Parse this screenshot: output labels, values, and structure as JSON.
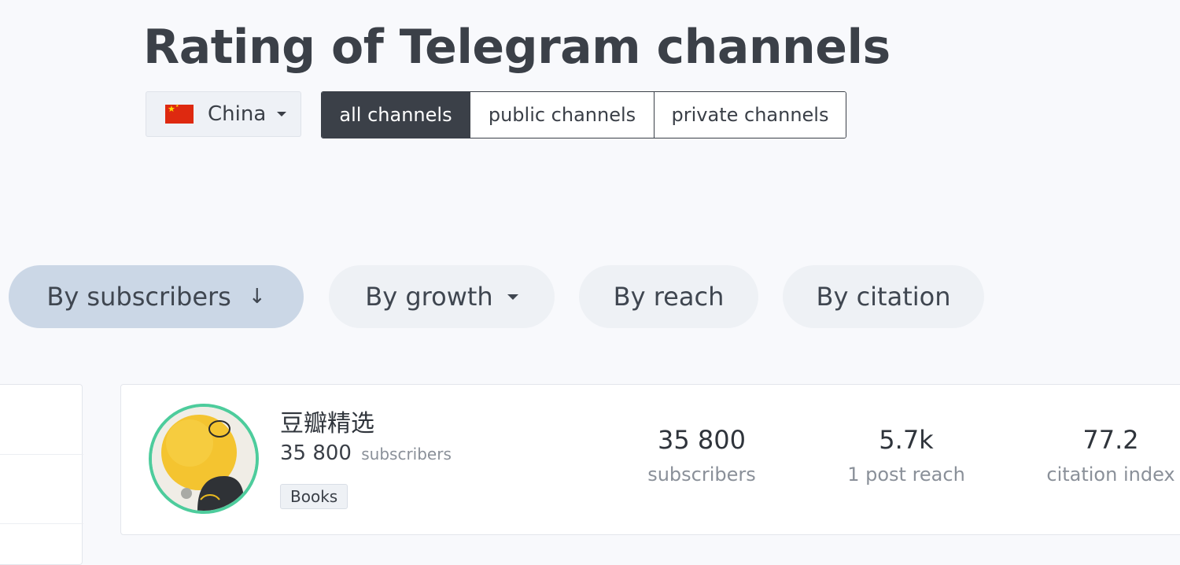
{
  "page": {
    "title": "Rating of Telegram channels"
  },
  "country_selector": {
    "label": "China",
    "flag_icon": "china-flag-icon"
  },
  "channel_type_tabs": [
    {
      "label": "all channels",
      "active": true
    },
    {
      "label": "public channels",
      "active": false
    },
    {
      "label": "private channels",
      "active": false
    }
  ],
  "sort_tabs": [
    {
      "label": "By subscribers",
      "active": true
    },
    {
      "label": "By growth",
      "active": false
    },
    {
      "label": "By reach",
      "active": false
    },
    {
      "label": "By citation",
      "active": false
    }
  ],
  "channel": {
    "name": "豆瓣精选",
    "subscribers_count": "35 800",
    "subscribers_label": "subscribers",
    "tag": "Books",
    "stats": [
      {
        "value": "35 800",
        "label": "subscribers"
      },
      {
        "value": "5.7k",
        "label": "1 post reach"
      },
      {
        "value": "77.2",
        "label": "citation index"
      }
    ]
  },
  "colors": {
    "accent_dark": "#3b4048",
    "avatar_ring": "#4dcc9c",
    "active_pill": "#cbd7e6"
  }
}
